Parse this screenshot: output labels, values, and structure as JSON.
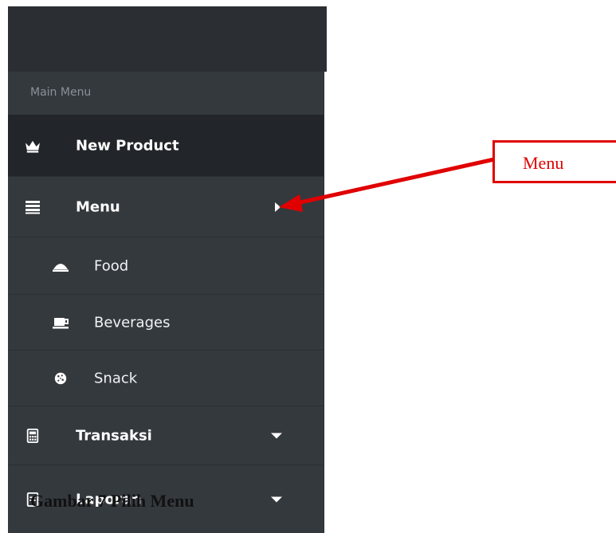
{
  "sidebar": {
    "section_label": "Main Menu",
    "items": [
      {
        "label": "New Product",
        "icon": "crown-icon"
      },
      {
        "label": "Menu",
        "icon": "list-icon"
      },
      {
        "label": "Food",
        "icon": "bell-icon"
      },
      {
        "label": "Beverages",
        "icon": "coffee-icon"
      },
      {
        "label": "Snack",
        "icon": "cookie-icon"
      },
      {
        "label": "Transaksi",
        "icon": "calculator-icon"
      },
      {
        "label": "Laporan",
        "icon": "report-icon"
      }
    ]
  },
  "annotation": {
    "callout_text": "Menu",
    "color": "#e00000"
  },
  "caption": "Gambar 7 Pilih Menu"
}
